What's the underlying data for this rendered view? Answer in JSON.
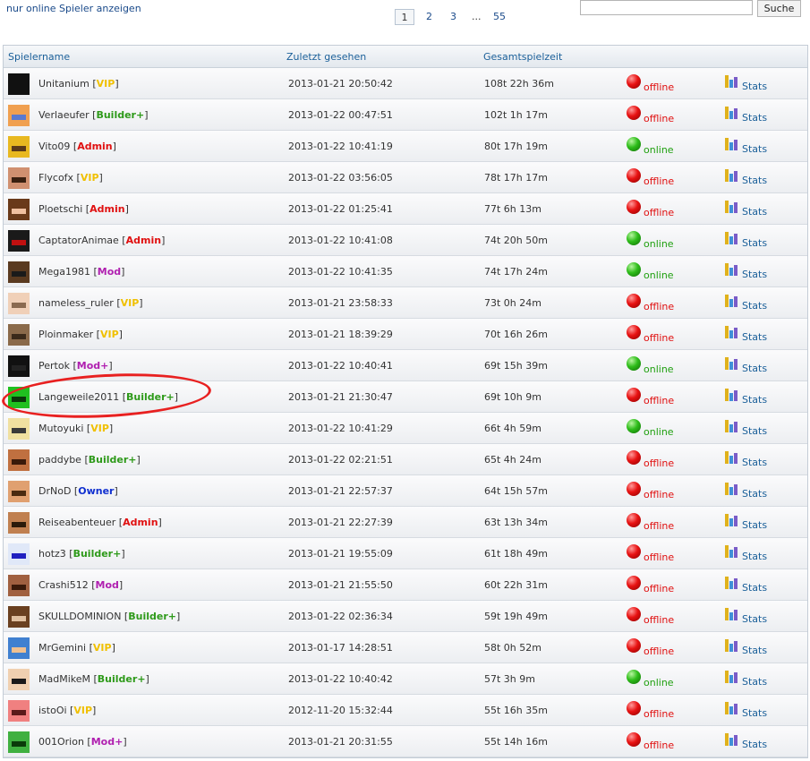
{
  "filter_link": "nur online Spieler anzeigen",
  "pagination": {
    "current": "1",
    "p2": "2",
    "p3": "3",
    "ellipsis": "...",
    "last": "55"
  },
  "search": {
    "value": "",
    "button": "Suche"
  },
  "columns": {
    "name": "Spielername",
    "last_seen": "Zuletzt gesehen",
    "playtime": "Gesamtspielzeit"
  },
  "stats_label": "Stats",
  "colors": {
    "VIP": "#f0c000",
    "Builder+": "#2e9a1a",
    "Admin": "#e01010",
    "Mod": "#b020b0",
    "Mod+": "#b020b0",
    "Owner": "#1030d0",
    "offline": "#e01010",
    "online": "#20a010"
  },
  "rows": [
    {
      "name": "Unitanium",
      "rank": "VIP",
      "seen": "2013-01-21 20:50:42",
      "time": "108t 22h 36m",
      "status": "offline",
      "avatar": "#111111",
      "face": "#111111"
    },
    {
      "name": "Verlaeufer",
      "rank": "Builder+",
      "seen": "2013-01-22 00:47:51",
      "time": "102t 1h 17m",
      "status": "offline",
      "avatar": "#f0a050",
      "face": "#5a7ad0"
    },
    {
      "name": "Vito09",
      "rank": "Admin",
      "seen": "2013-01-22 10:41:19",
      "time": "80t 17h 19m",
      "status": "online",
      "avatar": "#e8b820",
      "face": "#5a3a1a"
    },
    {
      "name": "Flycofx",
      "rank": "VIP",
      "seen": "2013-01-22 03:56:05",
      "time": "78t 17h 17m",
      "status": "offline",
      "avatar": "#d09070",
      "face": "#3a2010"
    },
    {
      "name": "Ploetschi",
      "rank": "Admin",
      "seen": "2013-01-22 01:25:41",
      "time": "77t 6h 13m",
      "status": "offline",
      "avatar": "#6a3a1a",
      "face": "#f0c0a0"
    },
    {
      "name": "CaptatorAnimae",
      "rank": "Admin",
      "seen": "2013-01-22 10:41:08",
      "time": "74t 20h 50m",
      "status": "online",
      "avatar": "#1a1a1a",
      "face": "#c01010"
    },
    {
      "name": "Mega1981",
      "rank": "Mod",
      "seen": "2013-01-22 10:41:35",
      "time": "74t 17h 24m",
      "status": "online",
      "avatar": "#5a3a20",
      "face": "#1a1a1a"
    },
    {
      "name": "nameless_ruler",
      "rank": "VIP",
      "seen": "2013-01-21 23:58:33",
      "time": "73t 0h 24m",
      "status": "offline",
      "avatar": "#f0d0b8",
      "face": "#8a6a50"
    },
    {
      "name": "Ploinmaker",
      "rank": "VIP",
      "seen": "2013-01-21 18:39:29",
      "time": "70t 16h 26m",
      "status": "offline",
      "avatar": "#8a6a4a",
      "face": "#3a2a1a"
    },
    {
      "name": "Pertok",
      "rank": "Mod+",
      "seen": "2013-01-22 10:40:41",
      "time": "69t 15h 39m",
      "status": "online",
      "avatar": "#111111",
      "face": "#222222"
    },
    {
      "name": "Langeweile2011",
      "rank": "Builder+",
      "seen": "2013-01-21 21:30:47",
      "time": "69t 10h 9m",
      "status": "offline",
      "avatar": "#20c020",
      "face": "#0a3a0a"
    },
    {
      "name": "Mutoyuki",
      "rank": "VIP",
      "seen": "2013-01-22 10:41:29",
      "time": "66t 4h 59m",
      "status": "online",
      "avatar": "#f0e0a0",
      "face": "#3a3a3a"
    },
    {
      "name": "paddybe",
      "rank": "Builder+",
      "seen": "2013-01-22 02:21:51",
      "time": "65t 4h 24m",
      "status": "offline",
      "avatar": "#c07040",
      "face": "#3a1a0a"
    },
    {
      "name": "DrNoD",
      "rank": "Owner",
      "seen": "2013-01-21 22:57:37",
      "time": "64t 15h 57m",
      "status": "offline",
      "avatar": "#e0a070",
      "face": "#4a2a10"
    },
    {
      "name": "Reiseabenteuer",
      "rank": "Admin",
      "seen": "2013-01-21 22:27:39",
      "time": "63t 13h 34m",
      "status": "offline",
      "avatar": "#c08050",
      "face": "#2a1a0a"
    },
    {
      "name": "hotz3",
      "rank": "Builder+",
      "seen": "2013-01-21 19:55:09",
      "time": "61t 18h 49m",
      "status": "offline",
      "avatar": "#e0e8f8",
      "face": "#2020c0"
    },
    {
      "name": "Crashi512",
      "rank": "Mod",
      "seen": "2013-01-21 21:55:50",
      "time": "60t 22h 31m",
      "status": "offline",
      "avatar": "#a06040",
      "face": "#3a1a0a"
    },
    {
      "name": "SKULLDOMINION",
      "rank": "Builder+",
      "seen": "2013-01-22 02:36:34",
      "time": "59t 19h 49m",
      "status": "offline",
      "avatar": "#6a4020",
      "face": "#e0c0a0"
    },
    {
      "name": "MrGemini",
      "rank": "VIP",
      "seen": "2013-01-17 14:28:51",
      "time": "58t 0h 52m",
      "status": "offline",
      "avatar": "#4080d0",
      "face": "#f0c090"
    },
    {
      "name": "MadMikeM",
      "rank": "Builder+",
      "seen": "2013-01-22 10:40:42",
      "time": "57t 3h 9m",
      "status": "online",
      "avatar": "#f0d0b0",
      "face": "#1a1a1a"
    },
    {
      "name": "istoOi",
      "rank": "VIP",
      "seen": "2012-11-20 15:32:44",
      "time": "55t 16h 35m",
      "status": "offline",
      "avatar": "#f08080",
      "face": "#5a1a1a"
    },
    {
      "name": "001Orion",
      "rank": "Mod+",
      "seen": "2013-01-21 20:31:55",
      "time": "55t 14h 16m",
      "status": "offline",
      "avatar": "#40b040",
      "face": "#0a3a0a"
    }
  ]
}
